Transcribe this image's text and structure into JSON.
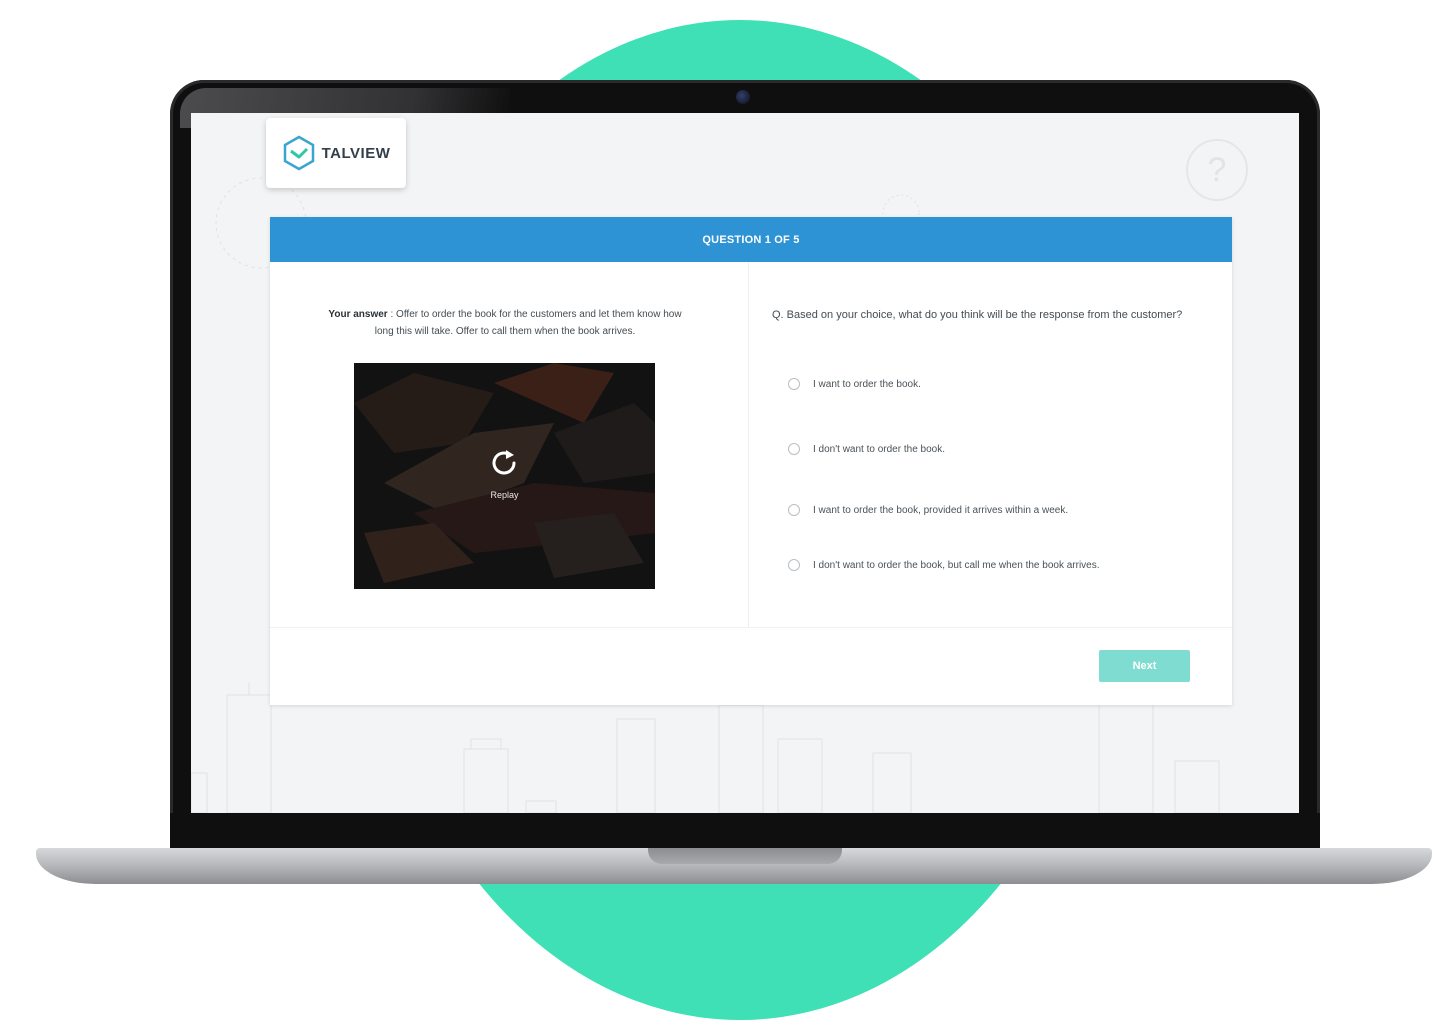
{
  "brand": {
    "name": "TALVIEW",
    "accent": "#2e93d4",
    "logo_icon": "talview-hexagon-icon"
  },
  "help": {
    "icon": "question-circle-icon",
    "glyph": "?"
  },
  "assessment": {
    "header": "QUESTION 1 OF 5",
    "answer_label": "Your answer",
    "answer_text": ": Offer to order the book for the customers and let them know how long this will take. Offer to call them when the book arrives.",
    "video": {
      "replay_label": "Replay",
      "replay_icon": "replay-icon"
    },
    "question": "Q. Based on your choice, what do you think will be the response from the customer?",
    "options": [
      {
        "label": "I want to order the book."
      },
      {
        "label": "I don't want to order the book."
      },
      {
        "label": "I want to order the book, provided it arrives within a week."
      },
      {
        "label": "I don't want to order the book, but call me when the book arrives."
      }
    ],
    "next_label": "Next",
    "next_color": "#7fdcd0"
  },
  "colors": {
    "background_circle": "#3fe0b5",
    "header_bar": "#2e93d4"
  }
}
